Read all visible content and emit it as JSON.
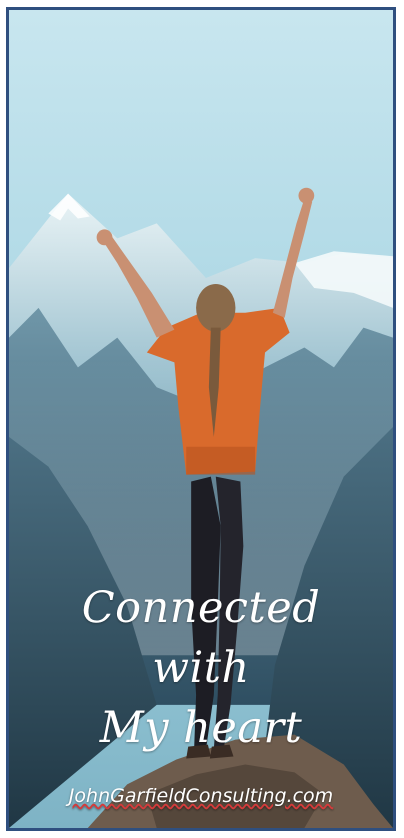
{
  "image": {
    "subject": "woman-on-mountain-summit"
  },
  "caption": {
    "line1": "Connected",
    "line2": "with",
    "line3": "My heart"
  },
  "website": "JohnGarfieldConsulting.com",
  "colors": {
    "frame": "#2f4f7f",
    "sky_top": "#bfe3ee",
    "sky_bottom": "#8ec5d8",
    "mountain_light": "#dbeef3",
    "mountain_dark": "#35586c",
    "shirt": "#d96a2c",
    "pants": "#1d1d24",
    "rock": "#6e5c4d"
  }
}
